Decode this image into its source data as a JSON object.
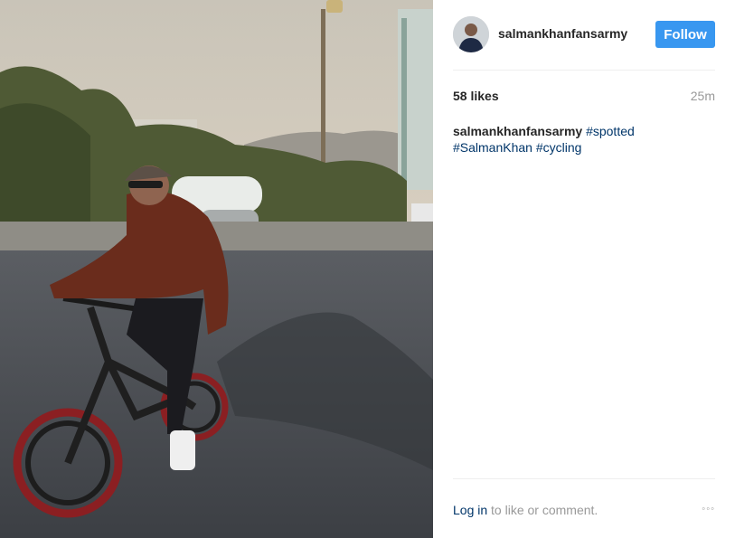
{
  "post": {
    "image_alt": "Man in cap and sunglasses riding a bicycle on a road",
    "author": {
      "username": "salmankhanfansarmy",
      "follow_label": "Follow"
    },
    "likes": "58 likes",
    "time": "25m",
    "caption": {
      "username": "salmankhanfansarmy",
      "hashtags": [
        "#spotted",
        "#SalmanKhan",
        "#cycling"
      ]
    },
    "footer": {
      "login_link": "Log in",
      "login_rest": " to like or comment.",
      "more_label": "◦◦◦"
    }
  },
  "colors": {
    "accent": "#3897f0",
    "link": "#003569",
    "muted": "#999999",
    "text": "#262626"
  }
}
